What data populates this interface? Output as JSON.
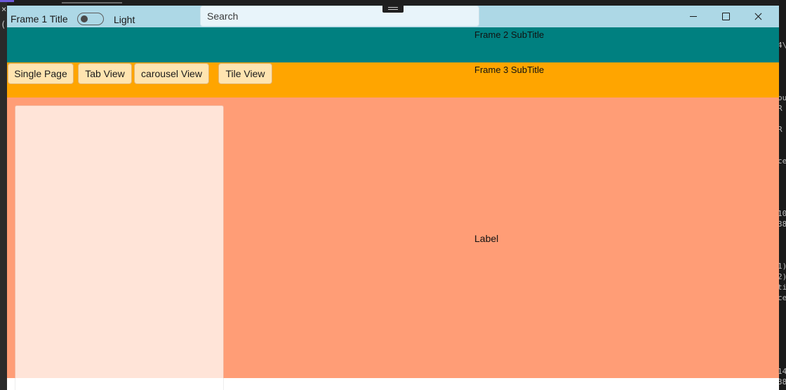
{
  "frame1": {
    "title": "Frame 1 Title",
    "theme_toggle": {
      "label": "Light",
      "on": false
    }
  },
  "search": {
    "placeholder": "Search"
  },
  "frame2": {
    "subtitle": "Frame 2 SubTitle",
    "color": "#008080"
  },
  "frame3": {
    "subtitle": "Frame 3 SubTitle",
    "color": "#ffa500",
    "buttons": [
      "Single Page",
      "Tab View",
      "carousel View",
      "Tile View"
    ]
  },
  "content": {
    "label": "Label",
    "color": "#ff9d76"
  },
  "background": {
    "left_glyphs": [
      "×",
      "("
    ],
    "right_fragments": [
      "4\\",
      "ou",
      " R",
      " R",
      "ce",
      "10",
      "38",
      "1)",
      "2)",
      "ti",
      "ce",
      "14",
      "38"
    ]
  }
}
